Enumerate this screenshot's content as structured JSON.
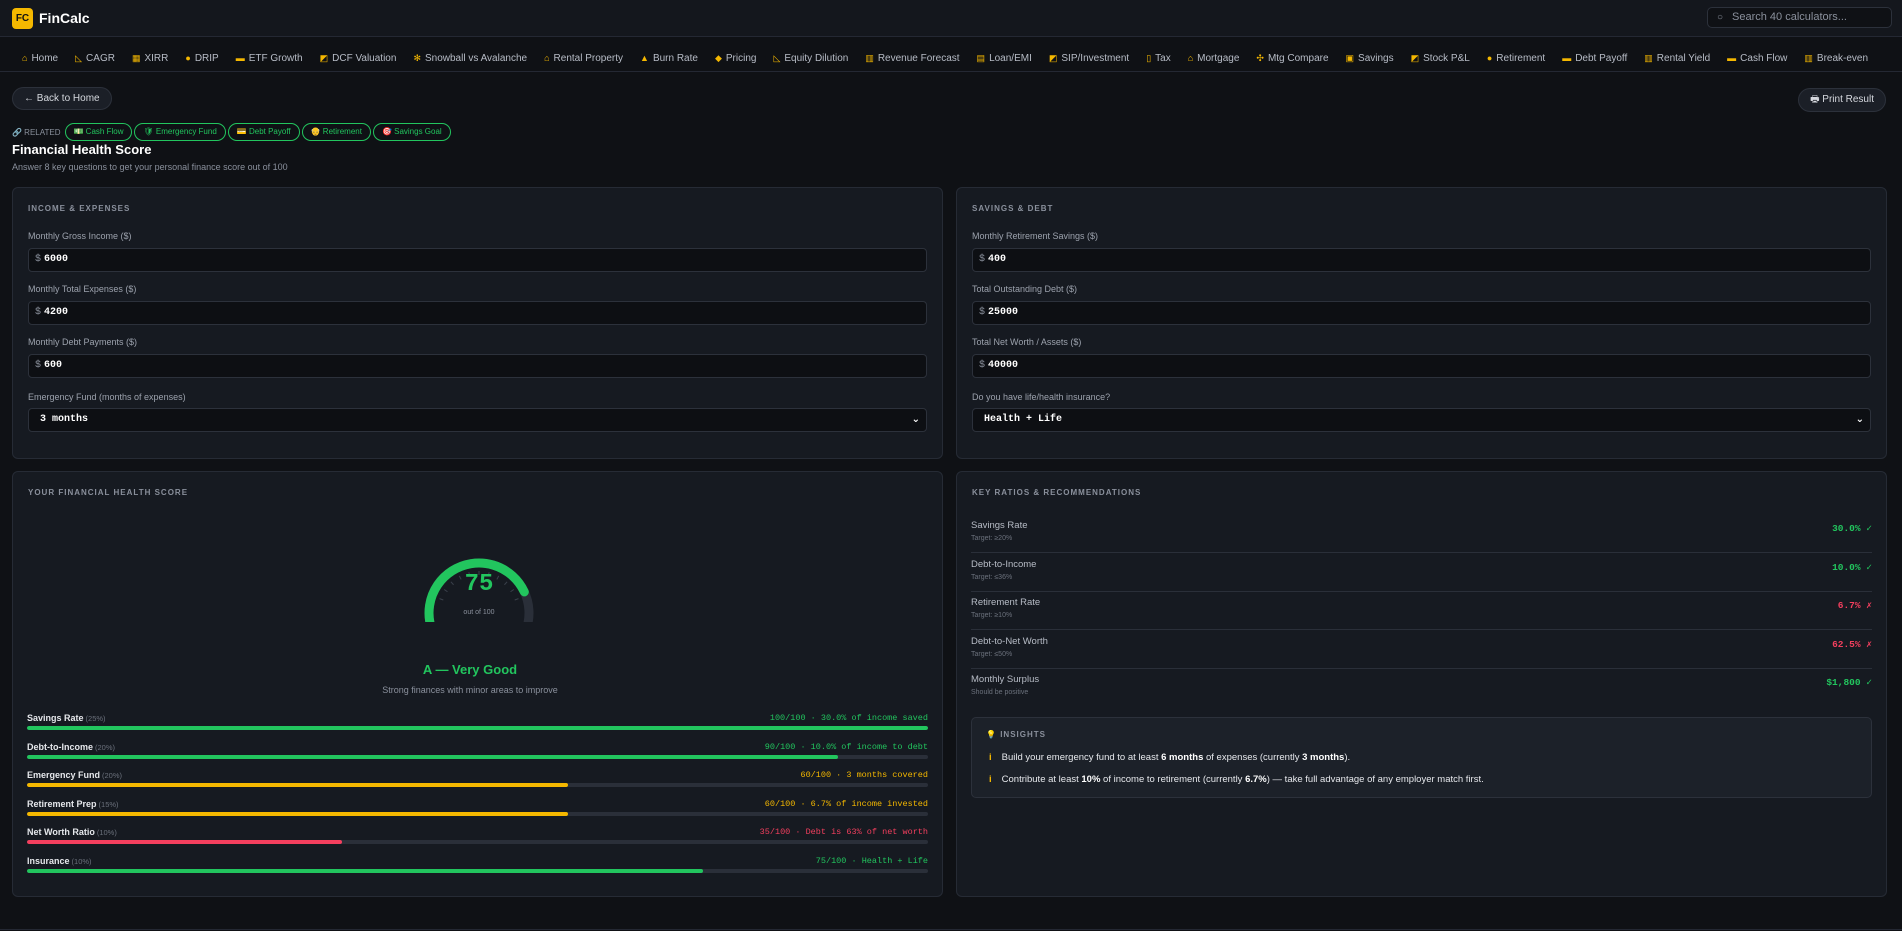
{
  "app": {
    "logo": "FC",
    "name": "FinCalc",
    "search_placeholder": "Search 40 calculators..."
  },
  "nav": [
    {
      "icon": "house-icon",
      "glyph": "⌂",
      "label": "Home"
    },
    {
      "icon": "ruler-icon",
      "glyph": "◺",
      "label": "CAGR"
    },
    {
      "icon": "calendar-icon",
      "glyph": "▦",
      "label": "XIRR"
    },
    {
      "icon": "droplet-icon",
      "glyph": "●",
      "label": "DRIP"
    },
    {
      "icon": "card-icon",
      "glyph": "▬",
      "label": "ETF Growth"
    },
    {
      "icon": "chart-icon",
      "glyph": "◩",
      "label": "DCF Valuation"
    },
    {
      "icon": "snowflake-icon",
      "glyph": "✻",
      "label": "Snowball vs Avalanche"
    },
    {
      "icon": "house-icon",
      "glyph": "⌂",
      "label": "Rental Property"
    },
    {
      "icon": "fire-icon",
      "glyph": "▲",
      "label": "Burn Rate"
    },
    {
      "icon": "tag-icon",
      "glyph": "◆",
      "label": "Pricing"
    },
    {
      "icon": "ruler-icon",
      "glyph": "◺",
      "label": "Equity Dilution"
    },
    {
      "icon": "bar-chart-icon",
      "glyph": "▥",
      "label": "Revenue Forecast"
    },
    {
      "icon": "document-icon",
      "glyph": "▤",
      "label": "Loan/EMI"
    },
    {
      "icon": "trend-icon",
      "glyph": "◩",
      "label": "SIP/Investment"
    },
    {
      "icon": "receipt-icon",
      "glyph": "▯",
      "label": "Tax"
    },
    {
      "icon": "house-icon",
      "glyph": "⌂",
      "label": "Mortgage"
    },
    {
      "icon": "compare-icon",
      "glyph": "✣",
      "label": "Mtg Compare"
    },
    {
      "icon": "bank-icon",
      "glyph": "▣",
      "label": "Savings"
    },
    {
      "icon": "chart-icon",
      "glyph": "◩",
      "label": "Stock P&L"
    },
    {
      "icon": "retirement-icon",
      "glyph": "●",
      "label": "Retirement"
    },
    {
      "icon": "card-icon",
      "glyph": "▬",
      "label": "Debt Payoff"
    },
    {
      "icon": "building-icon",
      "glyph": "▥",
      "label": "Rental Yield"
    },
    {
      "icon": "money-icon",
      "glyph": "▬",
      "label": "Cash Flow"
    },
    {
      "icon": "bar-chart-icon",
      "glyph": "▥",
      "label": "Break-even"
    }
  ],
  "actions": {
    "back": "← Back to Home",
    "print": "🖶 Print Result"
  },
  "related": {
    "label": "🔗 RELATED",
    "items": [
      "💵 Cash Flow",
      "🛡 Emergency Fund",
      "💳 Debt Payoff",
      "👴 Retirement",
      "🎯 Savings Goal"
    ]
  },
  "page": {
    "title": "Financial Health Score",
    "subtitle": "Answer 8 key questions to get your personal finance score out of 100"
  },
  "income": {
    "heading": "INCOME & EXPENSES",
    "currency": "$",
    "gross_label": "Monthly Gross Income ($)",
    "gross": "6000",
    "expenses_label": "Monthly Total Expenses ($)",
    "expenses": "4200",
    "debt_pay_label": "Monthly Debt Payments ($)",
    "debt_pay": "600",
    "emergency_label": "Emergency Fund (months of expenses)",
    "emergency": "3 months"
  },
  "savings": {
    "heading": "SAVINGS & DEBT",
    "currency": "$",
    "retire_label": "Monthly Retirement Savings ($)",
    "retire": "400",
    "debt_label": "Total Outstanding Debt ($)",
    "debt": "25000",
    "networth_label": "Total Net Worth / Assets ($)",
    "networth": "40000",
    "insurance_label": "Do you have life/health insurance?",
    "insurance": "Health + Life"
  },
  "score": {
    "heading": "YOUR FINANCIAL HEALTH SCORE",
    "value": "75",
    "score": 75,
    "out_of": "out of 100",
    "grade": "A — Very Good",
    "desc": "Strong finances with minor areas to improve",
    "gauge_color": "#22c55e"
  },
  "breakdown": [
    {
      "label": "Savings Rate",
      "weight": "(25%)",
      "value": "100/100 · 30.0% of income saved",
      "pct": 100,
      "color": "#22c55e"
    },
    {
      "label": "Debt-to-Income",
      "weight": "(20%)",
      "value": "90/100 · 10.0% of income to debt",
      "pct": 90,
      "color": "#22c55e"
    },
    {
      "label": "Emergency Fund",
      "weight": "(20%)",
      "value": "60/100 · 3 months covered",
      "pct": 60,
      "color": "#f5b800"
    },
    {
      "label": "Retirement Prep",
      "weight": "(15%)",
      "value": "60/100 · 6.7% of income invested",
      "pct": 60,
      "color": "#f5b800"
    },
    {
      "label": "Net Worth Ratio",
      "weight": "(10%)",
      "value": "35/100 · Debt is 63% of net worth",
      "pct": 35,
      "color": "#f43f5e"
    },
    {
      "label": "Insurance",
      "weight": "(10%)",
      "value": "75/100 · Health + Life",
      "pct": 75,
      "color": "#22c55e"
    }
  ],
  "ratios": {
    "heading": "KEY RATIOS & RECOMMENDATIONS",
    "items": [
      {
        "label": "Savings Rate",
        "target": "Target: ≥20%",
        "value": "30.0% ✓",
        "color": "#22c55e"
      },
      {
        "label": "Debt-to-Income",
        "target": "Target: ≤36%",
        "value": "10.0% ✓",
        "color": "#22c55e"
      },
      {
        "label": "Retirement Rate",
        "target": "Target: ≥10%",
        "value": "6.7% ✗",
        "color": "#f43f5e"
      },
      {
        "label": "Debt-to-Net Worth",
        "target": "Target: ≤50%",
        "value": "62.5% ✗",
        "color": "#f43f5e"
      },
      {
        "label": "Monthly Surplus",
        "target": "Should be positive",
        "value": "$1,800 ✓",
        "color": "#22c55e"
      }
    ]
  },
  "insights": {
    "heading": "INSIGHTS",
    "bulb": "💡",
    "icon": "i",
    "i1_a": "Build your emergency fund to at least ",
    "i1_b": "6 months",
    "i1_c": " of expenses (currently ",
    "i1_d": "3 months",
    "i1_e": ").",
    "i2_a": "Contribute at least ",
    "i2_b": "10%",
    "i2_c": " of income to retirement (currently ",
    "i2_d": "6.7%",
    "i2_e": ") — take full advantage of any employer match first."
  }
}
